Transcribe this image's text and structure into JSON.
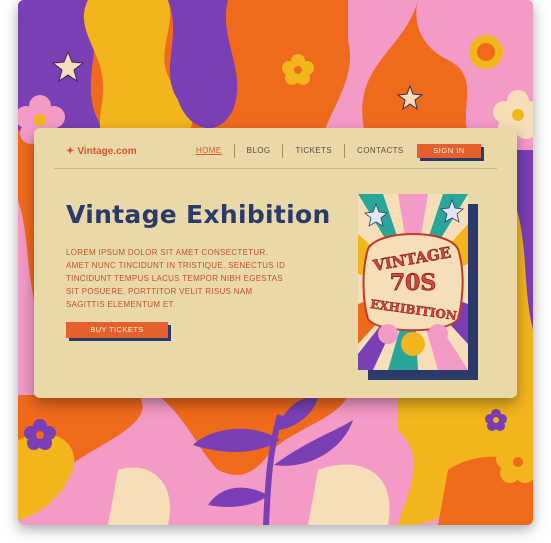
{
  "brand": {
    "name": "Vintage.com",
    "icon": "sparkle-icon"
  },
  "nav": {
    "links": [
      {
        "label": "HOME",
        "active": true
      },
      {
        "label": "BLOG",
        "active": false
      },
      {
        "label": "TICKETS",
        "active": false
      },
      {
        "label": "CONTACTS",
        "active": false
      }
    ],
    "signin_label": "SIGN IN"
  },
  "hero": {
    "title": "Vintage Exhibition",
    "body": "Lorem ipsum dolor sit amet consectetur. Amet nunc tincidunt in tristique. Senectus id tincidunt tempus lacus tempor nibh egestas sit posuere. Porttitor velit risus nam sagittis elementum et.",
    "cta_label": "BUY TICKETS"
  },
  "poster": {
    "line1": "VINTAGE",
    "line2": "70S",
    "line3": "EXHIBITION"
  },
  "colors": {
    "accent": "#e4602c",
    "navy": "#2b3a6b",
    "card": "#ead9a8",
    "purple": "#7a3fb5",
    "orange": "#f06a1c",
    "yellow": "#f2b51c",
    "pink": "#f39ac6",
    "cream": "#f6dfb8"
  }
}
